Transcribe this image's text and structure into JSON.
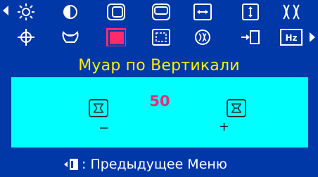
{
  "menu": {
    "title": "Муар по Вертикали",
    "icons_row1": [
      "brightness-icon",
      "contrast-icon",
      "horizontal-position-icon",
      "vertical-position-icon",
      "horizontal-size-icon",
      "vertical-size-icon",
      "pincushion-icon"
    ],
    "icons_row2": [
      "rotation-icon",
      "trapezoid-icon",
      "vertical-moire-icon",
      "zoom-icon",
      "degauss-icon",
      "input-select-icon",
      "frequency-icon"
    ],
    "selected_icon": "vertical-moire-icon",
    "frequency_badge": "Hz"
  },
  "adjust": {
    "value": "50",
    "minus": "−",
    "plus": "+"
  },
  "footer": {
    "label": ": Предыдущее Меню"
  },
  "colors": {
    "background": "#0038a8",
    "panel": "#00ffff",
    "title": "#ffee00",
    "value": "#e0307a",
    "selected": "#ff2a6a",
    "icon_stroke": "#ffffff"
  }
}
